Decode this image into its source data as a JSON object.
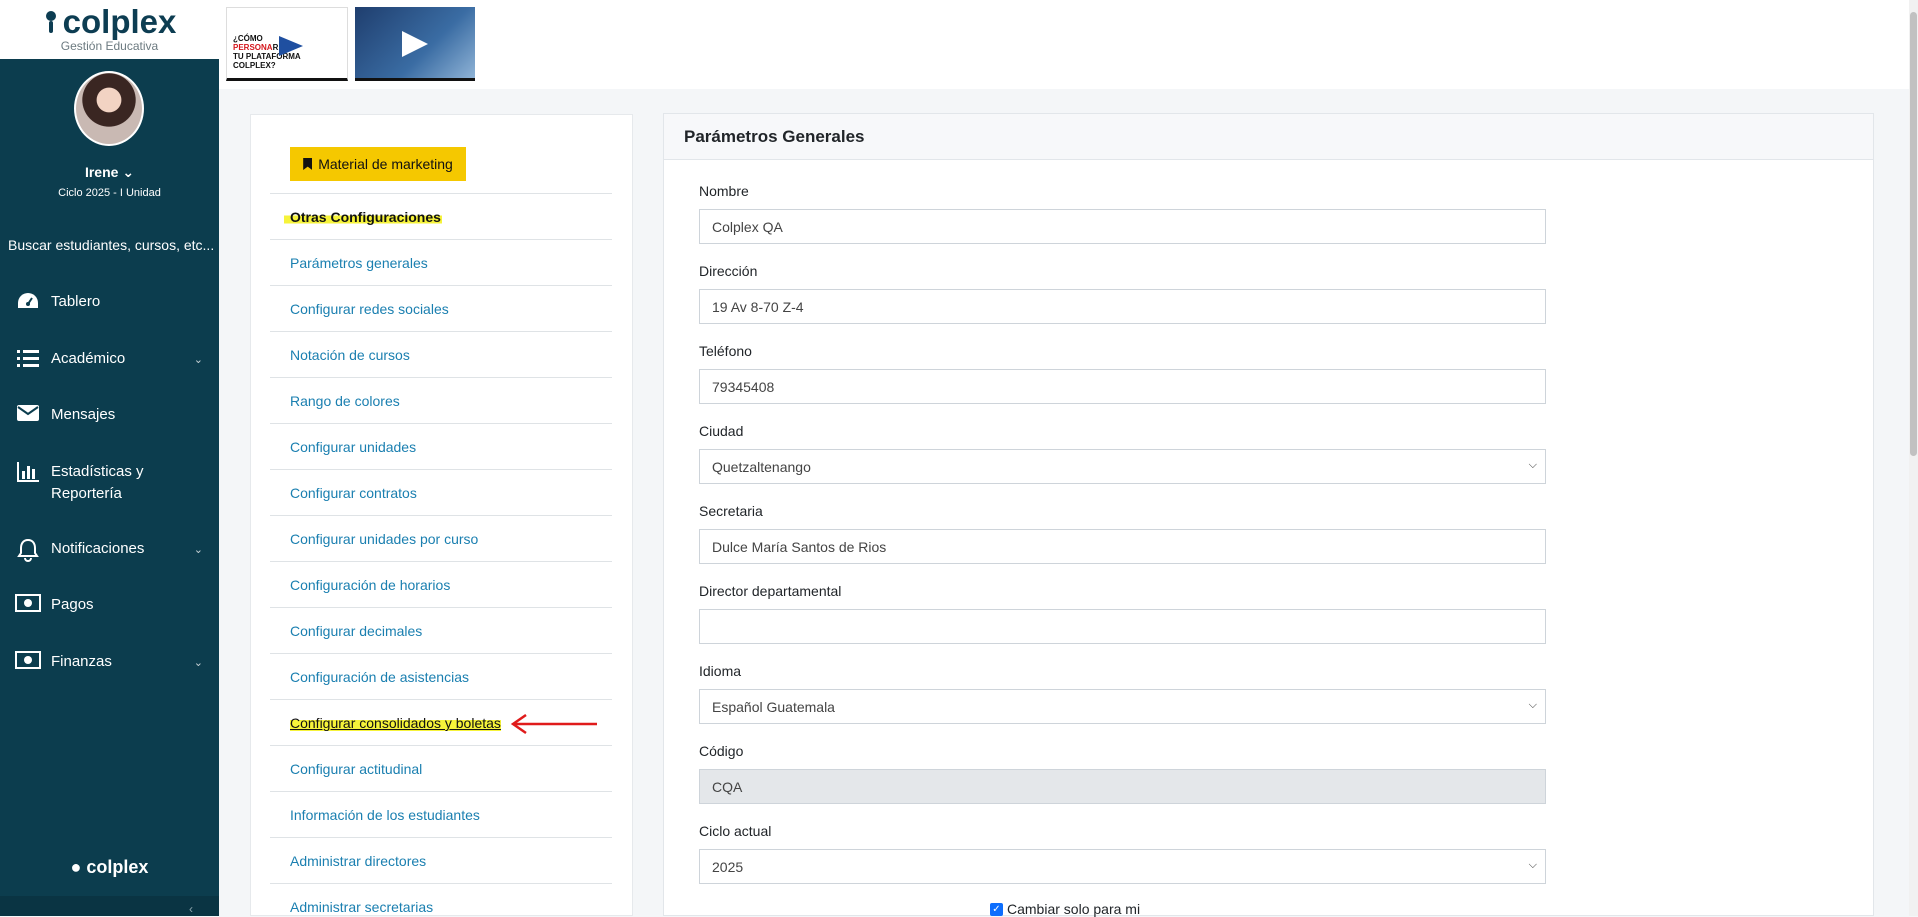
{
  "logo": {
    "brand": "colplex",
    "subtitle": "Gestión Educativa"
  },
  "user": {
    "name": "Irene",
    "cycle": "Ciclo 2025 - I Unidad"
  },
  "search": {
    "placeholder": "Buscar estudiantes, cursos, etc..."
  },
  "nav": [
    {
      "label": "Tablero",
      "icon": "dashboard-icon",
      "has_chevron": false
    },
    {
      "label": "Académico",
      "icon": "list-icon",
      "has_chevron": true
    },
    {
      "label": "Mensajes",
      "icon": "envelope-icon",
      "has_chevron": false
    },
    {
      "label": "Estadísticas y",
      "label2": "Reportería",
      "icon": "bar-chart-icon",
      "has_chevron": false
    },
    {
      "label": "Notificaciones",
      "icon": "bell-icon",
      "has_chevron": true
    },
    {
      "label": "Pagos",
      "icon": "money-icon",
      "has_chevron": false
    },
    {
      "label": "Finanzas",
      "icon": "money-icon",
      "has_chevron": true
    }
  ],
  "sidebar_footer": {
    "brand": "colplex"
  },
  "banners": {
    "first": {
      "line1": "¿CÓMO",
      "line2a": "PERSONA",
      "line2b": "R",
      "line3": "TU PLATAFORMA",
      "line4": "COLPLEX?"
    }
  },
  "config": {
    "marketing_button": "Material de marketing",
    "header": "Otras Configuraciones",
    "items": [
      "Parámetros generales",
      "Configurar redes sociales",
      "Notación de cursos",
      "Rango de colores",
      "Configurar unidades",
      "Configurar contratos",
      "Configurar unidades por curso",
      "Configuración de horarios",
      "Configurar decimales",
      "Configuración de asistencias",
      "Configurar consolidados y boletas",
      "Configurar actitudinal",
      "Información de los estudiantes",
      "Administrar directores",
      "Administrar secretarias"
    ],
    "highlighted_index": 10
  },
  "params": {
    "title": "Parámetros Generales",
    "fields": [
      {
        "label": "Nombre",
        "value": "Colplex QA",
        "type": "text"
      },
      {
        "label": "Dirección",
        "value": "19 Av 8-70 Z-4",
        "type": "text"
      },
      {
        "label": "Teléfono",
        "value": "79345408",
        "type": "text"
      },
      {
        "label": "Ciudad",
        "value": "Quetzaltenango",
        "type": "select"
      },
      {
        "label": "Secretaria",
        "value": "Dulce María Santos de Rios",
        "type": "text"
      },
      {
        "label": "Director departamental",
        "value": "",
        "type": "text"
      },
      {
        "label": "Idioma",
        "value": "Español Guatemala",
        "type": "select"
      },
      {
        "label": "Código",
        "value": "CQA",
        "type": "disabled"
      },
      {
        "label": "Ciclo actual",
        "value": "2025",
        "type": "select"
      }
    ],
    "checkbox_label": "Cambiar solo para mi",
    "checkbox_checked": true
  },
  "colors": {
    "sidebar": "#0c3d4e",
    "accent_yellow": "#f5c800",
    "link": "#1a7fb0",
    "highlight": "#f6f33a",
    "arrow": "#e01b1b"
  }
}
